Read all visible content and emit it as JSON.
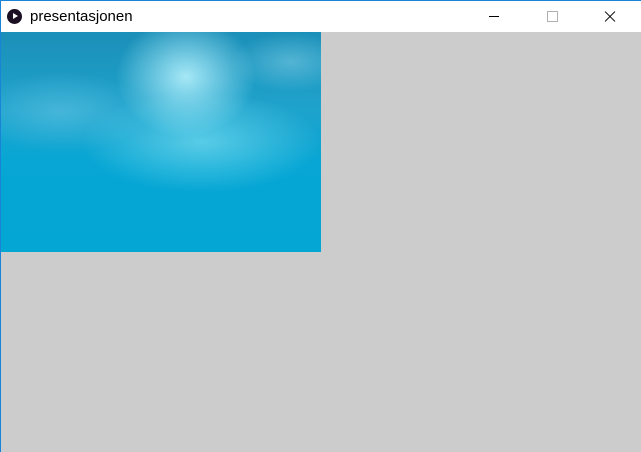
{
  "window": {
    "title": "presentasjonen",
    "app_icon": "processing-play-icon",
    "controls": [
      "minimize-icon",
      "maximize-icon",
      "close-icon"
    ]
  },
  "canvas": {
    "image": "underwater-surface-photo",
    "background": "#cccccc"
  }
}
